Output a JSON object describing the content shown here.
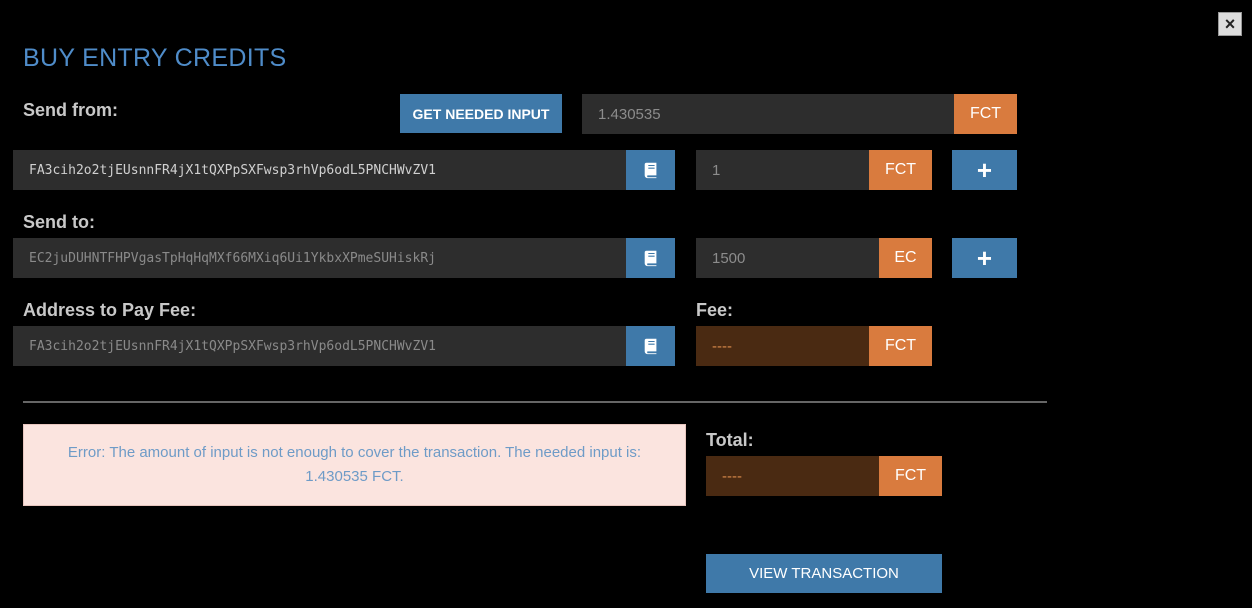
{
  "dialog": {
    "title": "BUY ENTRY CREDITS",
    "close_label": "×"
  },
  "send_from": {
    "label": "Send from:",
    "get_needed_input_label": "GET NEEDED INPUT",
    "needed_amount": "1.430535",
    "needed_unit": "FCT",
    "address": "FA3cih2o2tjEUsnnFR4jX1tQXPpSXFwsp3rhVp6odL5PNCHWvZV1",
    "amount": "1",
    "unit": "FCT",
    "add_label": "+"
  },
  "send_to": {
    "label": "Send to:",
    "address": "EC2juDUHNTFHPVgasTpHqHqMXf66MXiq6Ui1YkbxXPmeSUHiskRj",
    "amount": "1500",
    "unit": "EC",
    "add_label": "+"
  },
  "fee": {
    "address_label": "Address to Pay Fee:",
    "address": "FA3cih2o2tjEUsnnFR4jX1tQXPpSXFwsp3rhVp6odL5PNCHWvZV1",
    "label": "Fee:",
    "value": "----",
    "unit": "FCT"
  },
  "error": {
    "message": "Error: The amount of input is not enough to cover the transaction. The needed input is: 1.430535 FCT."
  },
  "total": {
    "label": "Total:",
    "value": "----",
    "unit": "FCT"
  },
  "view_transaction_label": "VIEW TRANSACTION",
  "colors": {
    "accent_blue": "#3f79a9",
    "accent_orange": "#d97b3e",
    "title_blue": "#4f8cc9",
    "error_bg": "#fbe4df"
  },
  "icons": {
    "address_book": "address-book-icon",
    "close": "close-icon"
  }
}
